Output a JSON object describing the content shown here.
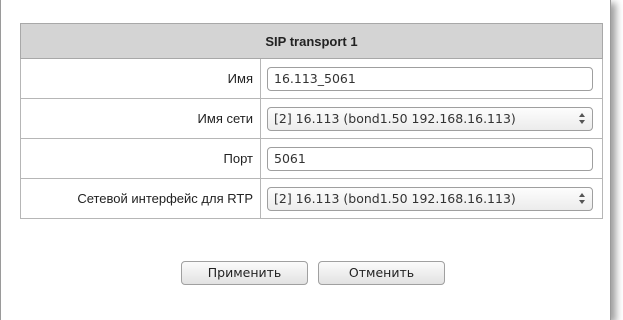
{
  "table": {
    "title": "SIP transport 1",
    "rows": [
      {
        "label": "Имя",
        "value": "16.113_5061",
        "kind": "input"
      },
      {
        "label": "Имя сети",
        "value": "[2] 16.113 (bond1.50 192.168.16.113)",
        "kind": "select"
      },
      {
        "label": "Порт",
        "value": "5061",
        "kind": "input"
      },
      {
        "label": "Сетевой интерфейс для RTP",
        "value": "[2] 16.113 (bond1.50 192.168.16.113)",
        "kind": "select"
      }
    ]
  },
  "buttons": {
    "apply_label": "Применить",
    "cancel_label": "Отменить"
  },
  "colors": {
    "header_bg": "#d4d4d4",
    "border": "#b6b6b6"
  },
  "icons": {
    "select_spinner": "updown-arrows-icon"
  }
}
